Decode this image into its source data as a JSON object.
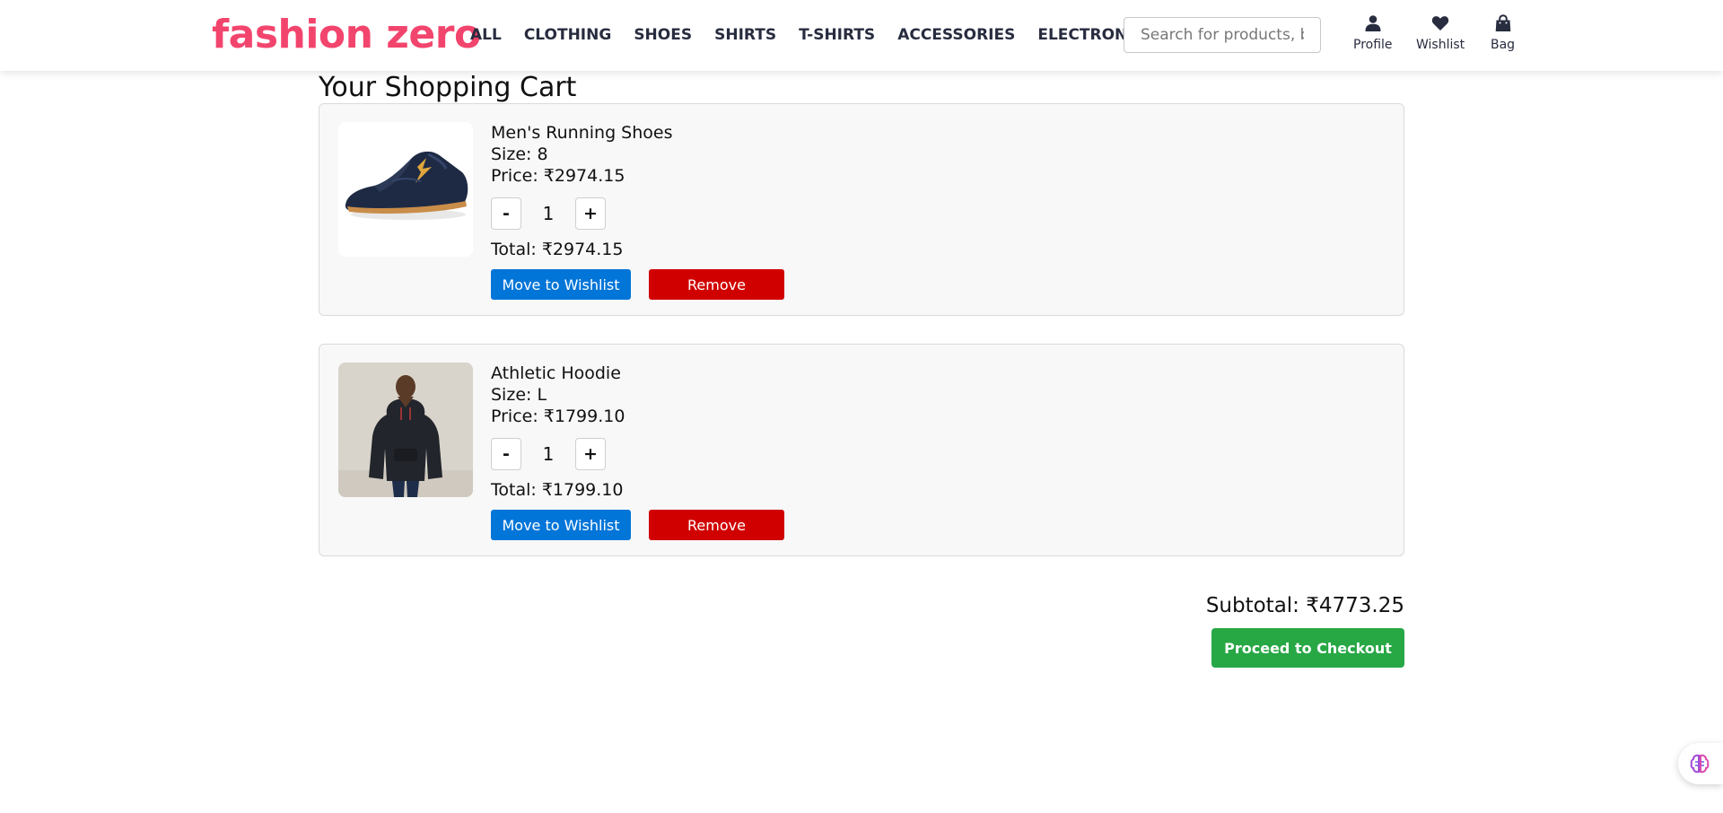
{
  "header": {
    "logo": "fashion zero",
    "nav": [
      "ALL",
      "CLOTHING",
      "SHOES",
      "SHIRTS",
      "T-SHIRTS",
      "ACCESSORIES",
      "ELECTRONICS"
    ],
    "search_placeholder": "Search for products, brands and more",
    "icons": [
      {
        "name": "profile-icon",
        "label": "Profile"
      },
      {
        "name": "heart-icon",
        "label": "Wishlist"
      },
      {
        "name": "bag-icon",
        "label": "Bag"
      }
    ]
  },
  "cart": {
    "title": "Your Shopping Cart",
    "items": [
      {
        "name": "Men's Running Shoes",
        "size": "Size: 8",
        "price": "Price: ₹2974.15",
        "qty": "1",
        "total": "Total: ₹2974.15",
        "minus": "-",
        "plus": "+",
        "wishlist_label": "Move to Wishlist",
        "remove_label": "Remove"
      },
      {
        "name": "Athletic Hoodie",
        "size": "Size: L",
        "price": "Price: ₹1799.10",
        "qty": "1",
        "total": "Total: ₹1799.10",
        "minus": "-",
        "plus": "+",
        "wishlist_label": "Move to Wishlist",
        "remove_label": "Remove"
      }
    ],
    "subtotal": "Subtotal: ₹4773.25",
    "checkout_label": "Proceed to Checkout"
  },
  "colors": {
    "brand": "#f2456d",
    "wishlist_button": "#0275d8",
    "remove_button": "#d10000",
    "checkout_button": "#28a745"
  }
}
